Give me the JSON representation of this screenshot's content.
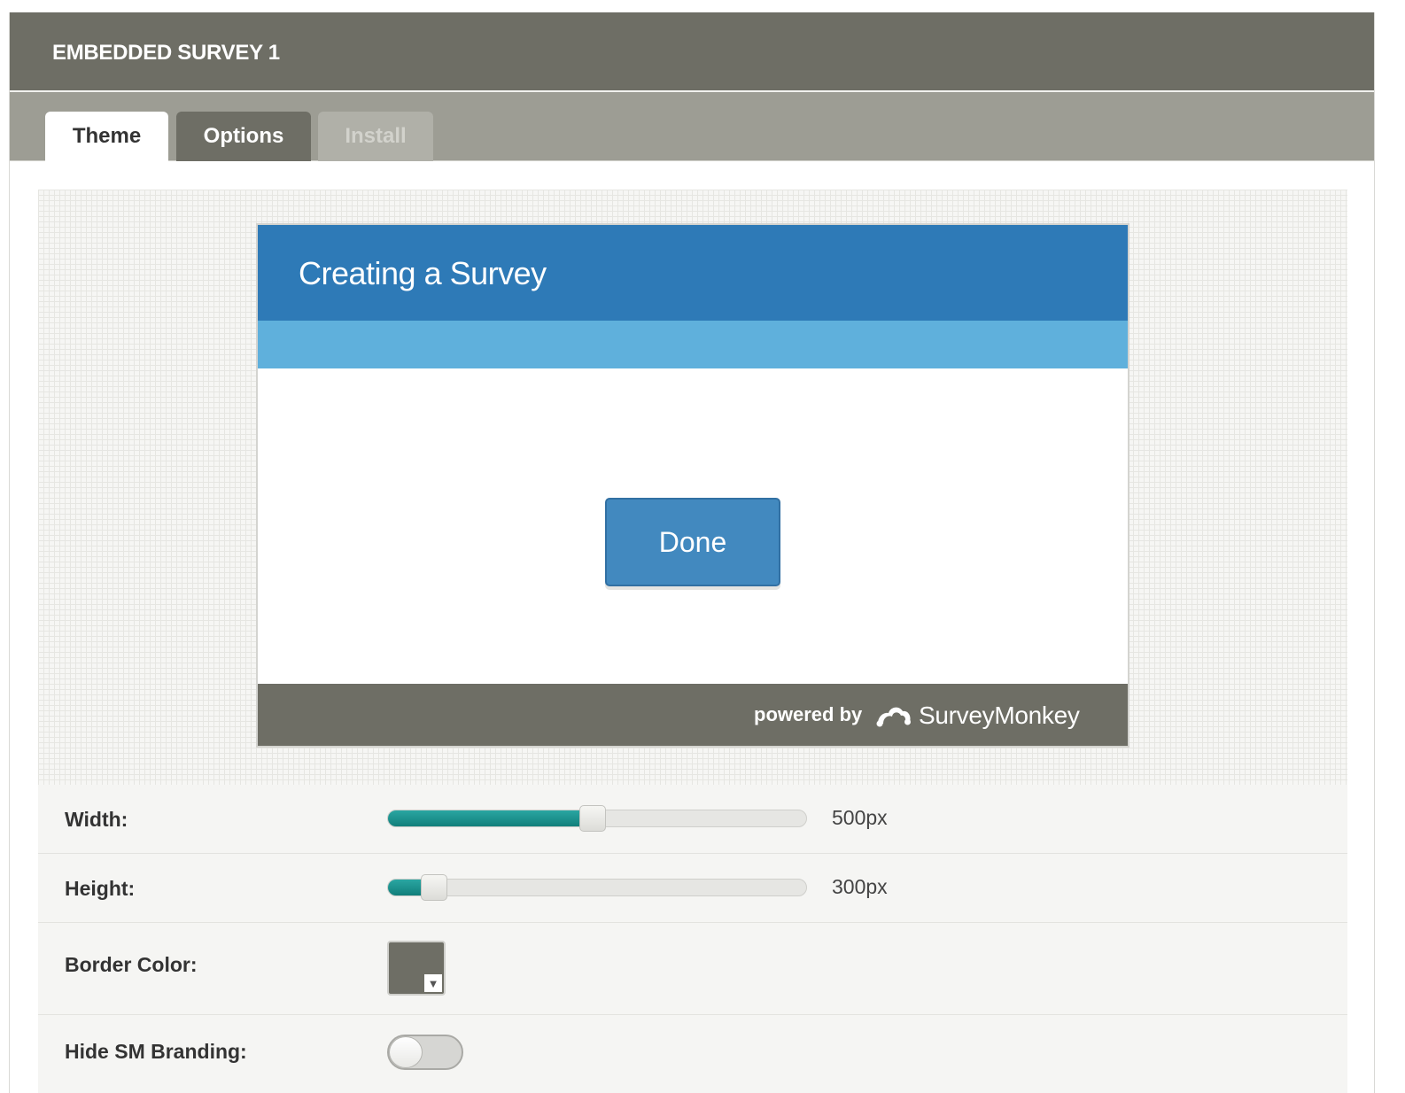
{
  "header": {
    "title": "EMBEDDED SURVEY 1"
  },
  "tabs": [
    {
      "label": "Theme",
      "state": "active"
    },
    {
      "label": "Options",
      "state": "normal"
    },
    {
      "label": "Install",
      "state": "disabled"
    }
  ],
  "preview": {
    "survey_title": "Creating a Survey",
    "done_label": "Done",
    "powered_by": "powered by",
    "brand_name": "SurveyMonkey",
    "header_color": "#2e7ab7",
    "progress_color": "#5fb0dc",
    "footer_color": "#6e6e65"
  },
  "settings": {
    "width": {
      "label": "Width:",
      "value_text": "500px",
      "fill_fraction": 0.49
    },
    "height": {
      "label": "Height:",
      "value_text": "300px",
      "fill_fraction": 0.11
    },
    "border_color": {
      "label": "Border Color:",
      "color": "#6e6e65"
    },
    "hide_branding": {
      "label": "Hide SM Branding:",
      "enabled": false
    }
  },
  "icons": {
    "swatch_dropdown": "▼",
    "brand_logo": "surveymonkey-logo-icon"
  }
}
